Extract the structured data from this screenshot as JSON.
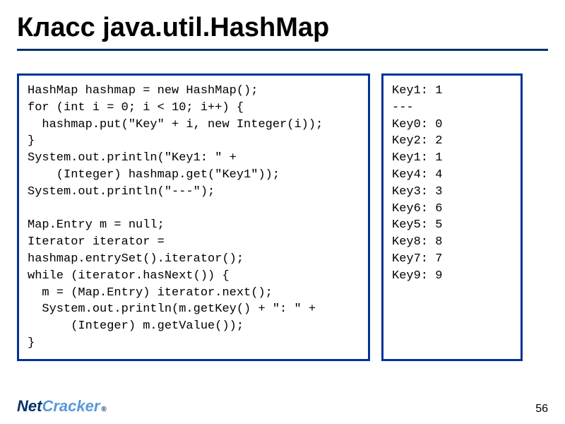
{
  "title": "Класс java.util.HashMap",
  "code_left": "HashMap hashmap = new HashMap();\nfor (int i = 0; i < 10; i++) {\n  hashmap.put(\"Key\" + i, new Integer(i));\n}\nSystem.out.println(\"Key1: \" +\n    (Integer) hashmap.get(\"Key1\"));\nSystem.out.println(\"---\");\n\nMap.Entry m = null;\nIterator iterator =\nhashmap.entrySet().iterator();\nwhile (iterator.hasNext()) {\n  m = (Map.Entry) iterator.next();\n  System.out.println(m.getKey() + \": \" +\n      (Integer) m.getValue());\n}",
  "code_right": "Key1: 1\n---\nKey0: 0\nKey2: 2\nKey1: 1\nKey4: 4\nKey3: 3\nKey6: 6\nKey5: 5\nKey8: 8\nKey7: 7\nKey9: 9",
  "logo": {
    "part1": "Net",
    "part2": "Cracker",
    "reg": "®"
  },
  "page_number": "56"
}
